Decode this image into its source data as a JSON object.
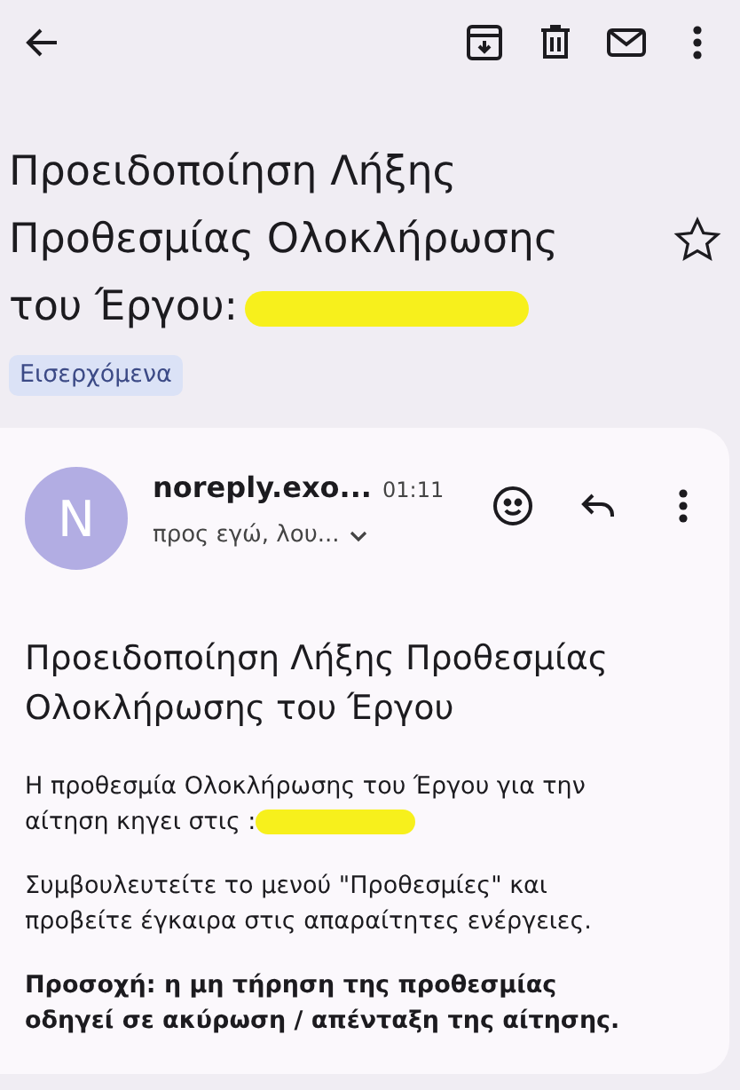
{
  "subject": {
    "text": "Προειδοποίηση Λήξης Προθεσμίας Ολοκλήρωσης του Έργου:",
    "starred": false
  },
  "label": "Εισερχόμενα",
  "message": {
    "avatar": "N",
    "sender": "noreply.exo...",
    "time": "01:11",
    "recipients": "προς εγώ, λου...",
    "heading": "Προειδοποίηση Λήξης Προθεσμίας Ολοκλήρωσης του Έργου",
    "paragraphs": [
      {
        "kind": "redacted",
        "text": "Η προθεσμία Ολοκλήρωσης του Έργου για την αίτηση κηγει στις :"
      },
      {
        "kind": "plain",
        "text": "Συμβουλευτείτε το μενού \"Προθεσμίες\" και προβείτε έγκαιρα στις απαραίτητες ενέργειες."
      },
      {
        "kind": "bold",
        "text": "Προσοχή: η μη τήρηση της προθεσμίας οδηγεί σε ακύρωση / απένταξη της αίτησης."
      }
    ]
  }
}
